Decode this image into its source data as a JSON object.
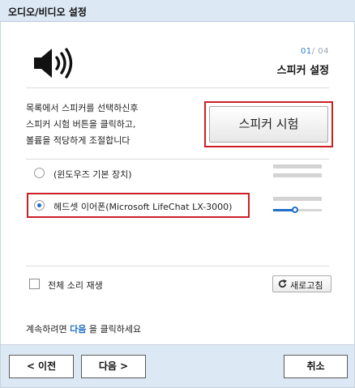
{
  "window": {
    "title": "오디오/비디오 설정"
  },
  "step": {
    "current": "01",
    "separator": "/",
    "total": "04",
    "title": "스피커 설정"
  },
  "instruction": {
    "line1": "목록에서 스피커를 선택하신후",
    "line2": "스피커 시험 버튼을 클릭하고,",
    "line3": "볼륨을 적당하게 조절합니다"
  },
  "test_button": {
    "label": "스피커 시험"
  },
  "devices": [
    {
      "label": "(윈도우즈 기본 장치)",
      "selected": false
    },
    {
      "label": "헤드셋 이어폰(Microsoft LifeChat LX-3000)",
      "selected": true,
      "volume": 0.48
    }
  ],
  "all_sound": {
    "label": "전체 소리 재생",
    "checked": false
  },
  "refresh": {
    "label": "새로고침",
    "icon": "refresh-icon"
  },
  "continue_hint": {
    "before": "계속하려면 ",
    "keyword": "다음",
    "after": " 을 클릭하세요"
  },
  "footer": {
    "prev": "< 이전",
    "next": "다음 >",
    "cancel": "취소"
  },
  "colors": {
    "accent": "#1f6fc8",
    "highlight_border": "#cc1f26",
    "titlebar": "#dce8f4"
  }
}
